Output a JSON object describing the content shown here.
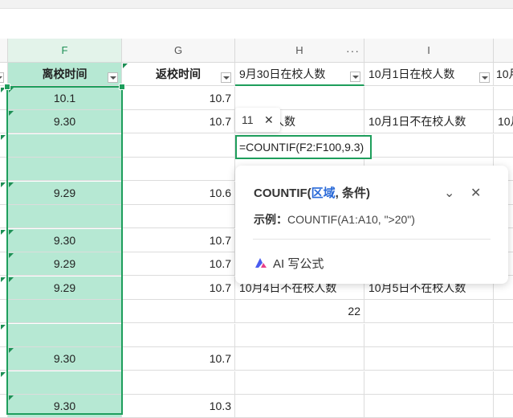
{
  "columns": {
    "F": "F",
    "G": "G",
    "H": "H",
    "I": "I"
  },
  "header_row": {
    "F": "离校时间",
    "G": "返校时间",
    "H": "9月30日在校人数",
    "I": "10月1日在校人数",
    "J": "10月"
  },
  "rows": [
    {
      "F": "10.1",
      "G": "10.7"
    },
    {
      "F": "9.30",
      "G": "10.7",
      "H": "不在校人数",
      "I": "10月1日不在校人数",
      "J": "10月"
    },
    {
      "F": "",
      "G": ""
    },
    {
      "F": "",
      "G": ""
    },
    {
      "F": "9.29",
      "G": "10.6"
    },
    {
      "F": "",
      "G": ""
    },
    {
      "F": "9.30",
      "G": "10.7"
    },
    {
      "F": "9.29",
      "G": "10.7"
    },
    {
      "F": "9.29",
      "G": "10.7",
      "H": "10月4日不在校人数",
      "I": "10月5日不在校人数"
    },
    {
      "F": "",
      "G": "",
      "H": "22"
    },
    {
      "F": "",
      "G": ""
    },
    {
      "F": "9.30",
      "G": "10.7"
    },
    {
      "F": "",
      "G": ""
    },
    {
      "F": "9.30",
      "G": "10.3"
    }
  ],
  "editor": {
    "formula": "=COUNTIF(F2:F100,9.3)"
  },
  "chip": {
    "value": "11",
    "close": "✕"
  },
  "popup": {
    "fn": "COUNTIF(",
    "arg1": "区域",
    "sep": ",  ",
    "arg2": "条件)",
    "example_label": "示例：",
    "example_text": "COUNTIF(A1:A10, \">20\")",
    "ai_label": "AI 写公式",
    "collapse": "⌄",
    "close": "✕"
  },
  "colors": {
    "selection": "#1e9e5c",
    "fill": "#b6e8d3",
    "accent": "#2a6ad8"
  }
}
